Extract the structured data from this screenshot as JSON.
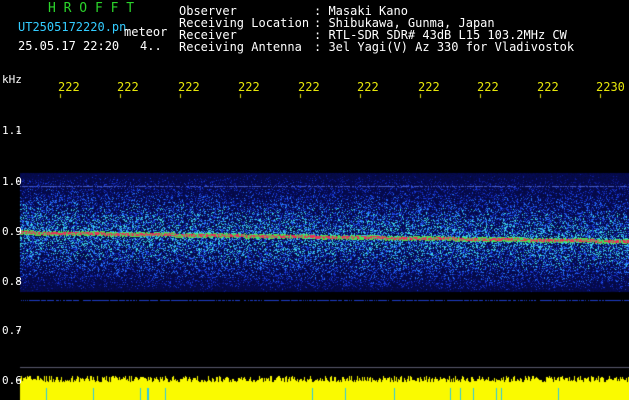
{
  "app": {
    "title": "H R O F F T",
    "filename": "UT2505172220.pn",
    "meteor_label": "meteor",
    "datetime": "25.05.17 22:20",
    "count": "4.."
  },
  "info": {
    "observer_label": "Observer",
    "observer_value": ": Masaki Kano",
    "location_label": "Receiving Location",
    "location_value": ": Shibukawa, Gunma, Japan",
    "receiver_label": "Receiver",
    "receiver_value": ": RTL-SDR SDR# 43dB L15 103.2MHz CW",
    "antenna_label": "Receiving Antenna",
    "antenna_value": ": 3el Yagi(V) Az 330 for Vladivostok"
  },
  "yaxis": {
    "unit": "kHz",
    "ticks": [
      "1.1",
      "1.0",
      "0.9",
      "0.8",
      "0.7",
      "0.6"
    ]
  },
  "xaxis": {
    "ticks": [
      "222",
      "222",
      "222",
      "222",
      "222",
      "222",
      "222",
      "222",
      "222",
      "2230"
    ]
  },
  "colors": {
    "background": "#000000",
    "title_green": "#2bd42b",
    "tick_yellow": "#e6e60a",
    "info_white": "#ffffff",
    "line_cyan": "#33ccff",
    "spectrum_yellow": "#ffff00"
  }
}
